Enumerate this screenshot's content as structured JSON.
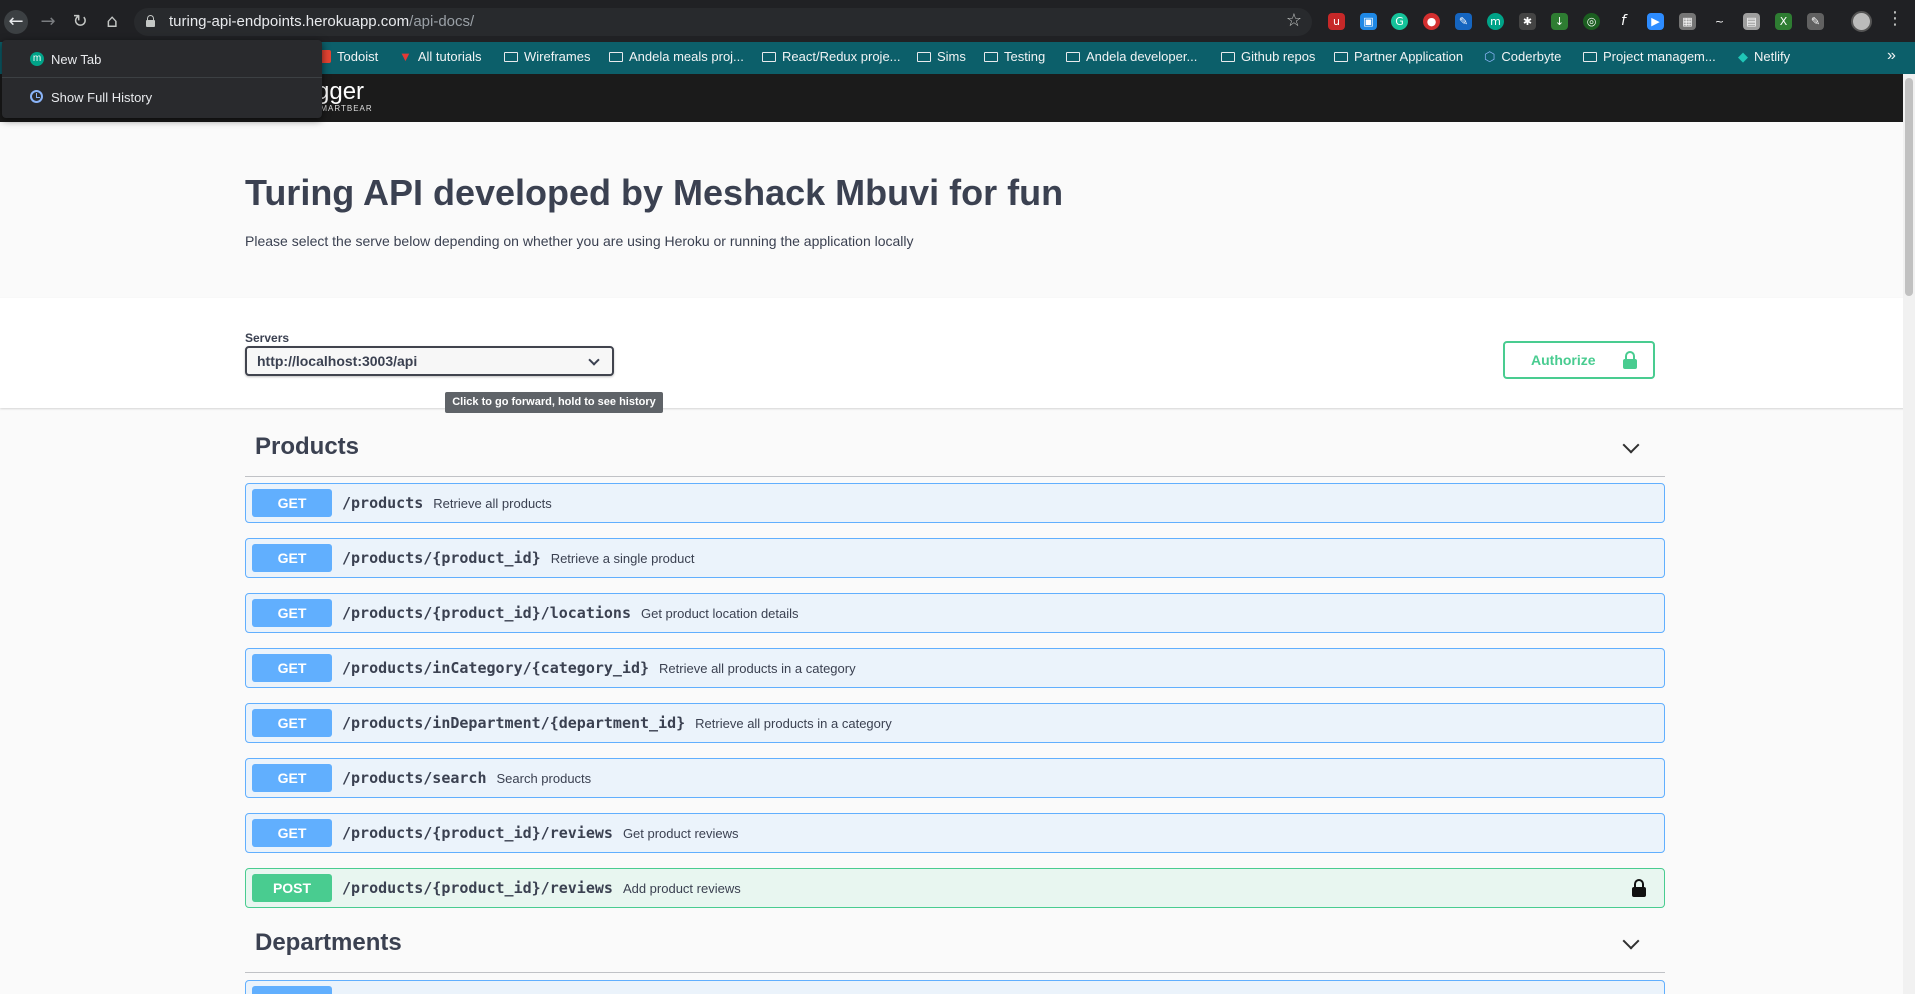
{
  "browser": {
    "url_host": "turing-api-endpoints.herokuapp.com",
    "url_path": "/api-docs/",
    "nav_icons": {
      "back": "back-arrow-icon",
      "forward": "forward-arrow-icon",
      "reload": "reload-icon",
      "home": "home-icon"
    },
    "bookmarks": [
      "Todoist",
      "All tutorials",
      "Wireframes",
      "Andela meals proj...",
      "React/Redux proje...",
      "Sims",
      "Testing",
      "Andela developer...",
      "Github repos",
      "Partner Application",
      "Coderbyte",
      "Project managem...",
      "Netlify"
    ],
    "bookmarks_more": "»",
    "tooltip": "Click to go forward, hold to see history",
    "history_menu": {
      "items": [
        "New Tab",
        "Show Full History"
      ]
    }
  },
  "swagger": {
    "logo_text": "gger",
    "logo_sub": "SMARTBEAR",
    "title": "Turing API developed by Meshack Mbuvi for fun",
    "description": "Please select the serve below depending on whether you are using Heroku or running the application locally",
    "servers_label": "Servers",
    "server_selected": "http://localhost:3003/api",
    "authorize_label": "Authorize"
  },
  "tags": [
    {
      "name": "Products",
      "operations": [
        {
          "method": "GET",
          "path": "/products",
          "summary": "Retrieve all products",
          "locked": false
        },
        {
          "method": "GET",
          "path": "/products/{product_id}",
          "summary": "Retrieve a single product",
          "locked": false
        },
        {
          "method": "GET",
          "path": "/products/{product_id}/locations",
          "summary": "Get product location details",
          "locked": false
        },
        {
          "method": "GET",
          "path": "/products/inCategory/{category_id}",
          "summary": "Retrieve all products in a category",
          "locked": false
        },
        {
          "method": "GET",
          "path": "/products/inDepartment/{department_id}",
          "summary": "Retrieve all products in a category",
          "locked": false
        },
        {
          "method": "GET",
          "path": "/products/search",
          "summary": "Search products",
          "locked": false
        },
        {
          "method": "GET",
          "path": "/products/{product_id}/reviews",
          "summary": "Get product reviews",
          "locked": false
        },
        {
          "method": "POST",
          "path": "/products/{product_id}/reviews",
          "summary": "Add product reviews",
          "locked": true
        }
      ]
    },
    {
      "name": "Departments",
      "operations": []
    }
  ],
  "colors": {
    "get": "#61affe",
    "post": "#49cc90",
    "topbar": "#202124",
    "bookmarks_bar": "#0c5f6a"
  }
}
